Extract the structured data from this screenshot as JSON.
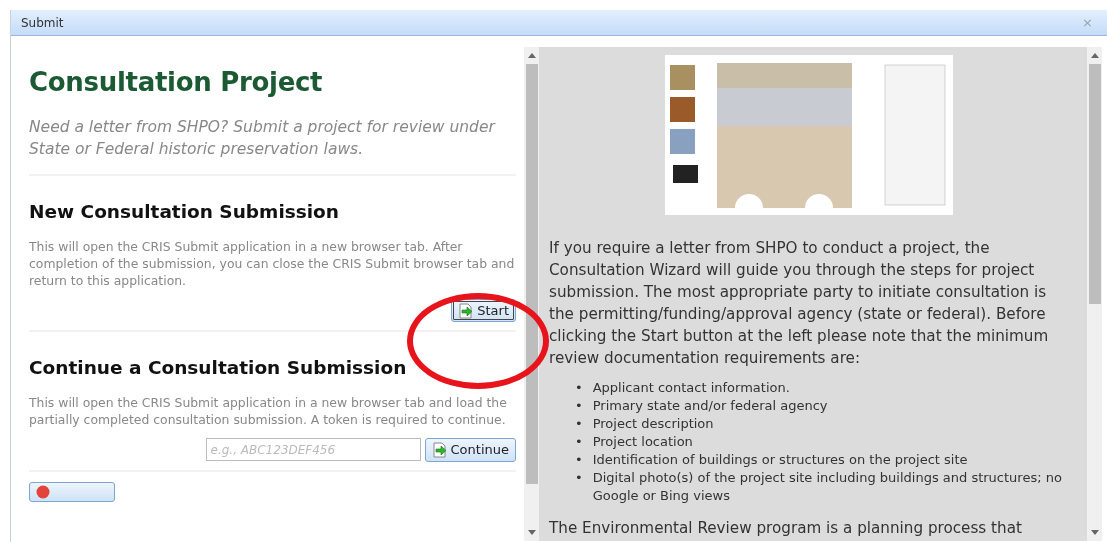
{
  "window": {
    "title": "Submit",
    "close": "×"
  },
  "left": {
    "title": "Consultation Project",
    "intro": "Need a letter from SHPO? Submit a project for review under State or Federal historic preservation laws.",
    "sections": [
      {
        "heading": "New Consultation Submission",
        "text": "This will open the CRIS Submit application in a new browser tab. After completion of the submission, you can close the CRIS Submit browser tab and return to this application.",
        "button": "Start"
      },
      {
        "heading": "Continue a Consultation Submission",
        "text": "This will open the CRIS Submit application in a new browser tab and load the partially completed consultation submission. A token is required to continue.",
        "placeholder": "e.g., ABC123DEF456",
        "button": "Continue"
      }
    ]
  },
  "right": {
    "intro": "If you require a letter from SHPO to conduct a project, the Consultation Wizard will guide you through the steps for project submission. The most appropriate party to initiate consultation is the permitting/funding/approval agency (state or federal). Before clicking the Start button at the left please note that the minimum review documentation requirements are:",
    "bullet": "•",
    "requirements": [
      "Applicant contact information.",
      "Primary state and/or federal agency",
      "Project description",
      "Project location",
      "Identification of buildings or structures on the project site",
      "Digital photo(s) of the project site including buildings and structures; no Google or Bing views"
    ],
    "outro": "The Environmental Review program is a planning process that"
  }
}
